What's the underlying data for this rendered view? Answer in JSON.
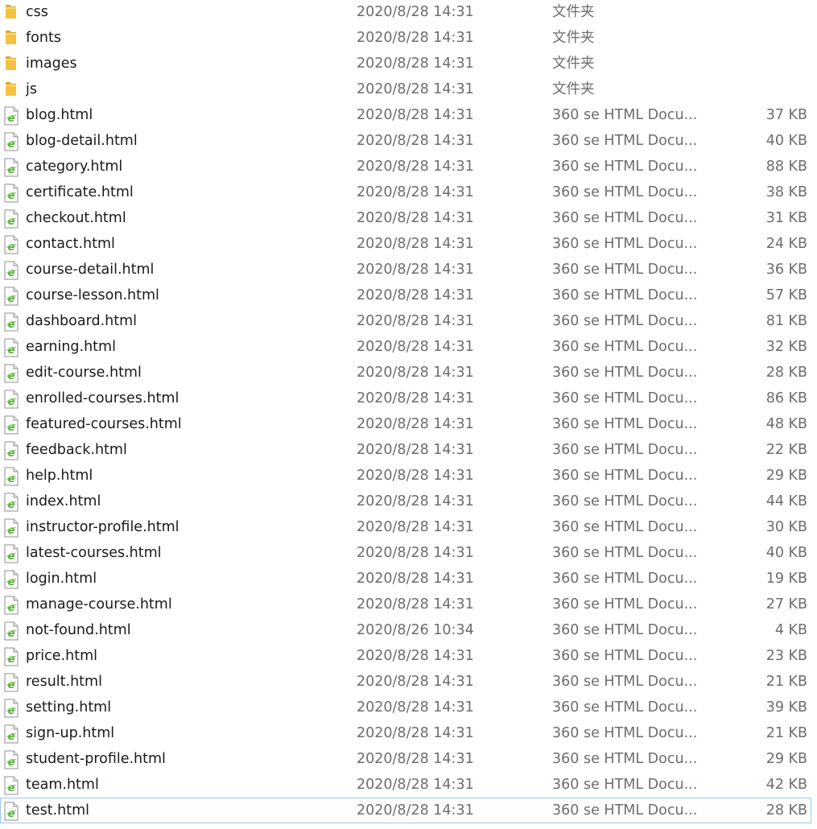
{
  "files": [
    {
      "name": "css",
      "date": "2020/8/28 14:31",
      "type": "文件夹",
      "size": "",
      "icon": "folder-icon"
    },
    {
      "name": "fonts",
      "date": "2020/8/28 14:31",
      "type": "文件夹",
      "size": "",
      "icon": "folder-icon"
    },
    {
      "name": "images",
      "date": "2020/8/28 14:31",
      "type": "文件夹",
      "size": "",
      "icon": "folder-icon"
    },
    {
      "name": "js",
      "date": "2020/8/28 14:31",
      "type": "文件夹",
      "size": "",
      "icon": "folder-icon"
    },
    {
      "name": "blog.html",
      "date": "2020/8/28 14:31",
      "type": "360 se HTML Docu...",
      "size": "37 KB",
      "icon": "html-file-icon"
    },
    {
      "name": "blog-detail.html",
      "date": "2020/8/28 14:31",
      "type": "360 se HTML Docu...",
      "size": "40 KB",
      "icon": "html-file-icon"
    },
    {
      "name": "category.html",
      "date": "2020/8/28 14:31",
      "type": "360 se HTML Docu...",
      "size": "88 KB",
      "icon": "html-file-icon"
    },
    {
      "name": "certificate.html",
      "date": "2020/8/28 14:31",
      "type": "360 se HTML Docu...",
      "size": "38 KB",
      "icon": "html-file-icon"
    },
    {
      "name": "checkout.html",
      "date": "2020/8/28 14:31",
      "type": "360 se HTML Docu...",
      "size": "31 KB",
      "icon": "html-file-icon"
    },
    {
      "name": "contact.html",
      "date": "2020/8/28 14:31",
      "type": "360 se HTML Docu...",
      "size": "24 KB",
      "icon": "html-file-icon"
    },
    {
      "name": "course-detail.html",
      "date": "2020/8/28 14:31",
      "type": "360 se HTML Docu...",
      "size": "36 KB",
      "icon": "html-file-icon"
    },
    {
      "name": "course-lesson.html",
      "date": "2020/8/28 14:31",
      "type": "360 se HTML Docu...",
      "size": "57 KB",
      "icon": "html-file-icon"
    },
    {
      "name": "dashboard.html",
      "date": "2020/8/28 14:31",
      "type": "360 se HTML Docu...",
      "size": "81 KB",
      "icon": "html-file-icon"
    },
    {
      "name": "earning.html",
      "date": "2020/8/28 14:31",
      "type": "360 se HTML Docu...",
      "size": "32 KB",
      "icon": "html-file-icon"
    },
    {
      "name": "edit-course.html",
      "date": "2020/8/28 14:31",
      "type": "360 se HTML Docu...",
      "size": "28 KB",
      "icon": "html-file-icon"
    },
    {
      "name": "enrolled-courses.html",
      "date": "2020/8/28 14:31",
      "type": "360 se HTML Docu...",
      "size": "86 KB",
      "icon": "html-file-icon"
    },
    {
      "name": "featured-courses.html",
      "date": "2020/8/28 14:31",
      "type": "360 se HTML Docu...",
      "size": "48 KB",
      "icon": "html-file-icon"
    },
    {
      "name": "feedback.html",
      "date": "2020/8/28 14:31",
      "type": "360 se HTML Docu...",
      "size": "22 KB",
      "icon": "html-file-icon"
    },
    {
      "name": "help.html",
      "date": "2020/8/28 14:31",
      "type": "360 se HTML Docu...",
      "size": "29 KB",
      "icon": "html-file-icon"
    },
    {
      "name": "index.html",
      "date": "2020/8/28 14:31",
      "type": "360 se HTML Docu...",
      "size": "44 KB",
      "icon": "html-file-icon"
    },
    {
      "name": "instructor-profile.html",
      "date": "2020/8/28 14:31",
      "type": "360 se HTML Docu...",
      "size": "30 KB",
      "icon": "html-file-icon"
    },
    {
      "name": "latest-courses.html",
      "date": "2020/8/28 14:31",
      "type": "360 se HTML Docu...",
      "size": "40 KB",
      "icon": "html-file-icon"
    },
    {
      "name": "login.html",
      "date": "2020/8/28 14:31",
      "type": "360 se HTML Docu...",
      "size": "19 KB",
      "icon": "html-file-icon"
    },
    {
      "name": "manage-course.html",
      "date": "2020/8/28 14:31",
      "type": "360 se HTML Docu...",
      "size": "27 KB",
      "icon": "html-file-icon"
    },
    {
      "name": "not-found.html",
      "date": "2020/8/26 10:34",
      "type": "360 se HTML Docu...",
      "size": "4 KB",
      "icon": "html-file-icon"
    },
    {
      "name": "price.html",
      "date": "2020/8/28 14:31",
      "type": "360 se HTML Docu...",
      "size": "23 KB",
      "icon": "html-file-icon"
    },
    {
      "name": "result.html",
      "date": "2020/8/28 14:31",
      "type": "360 se HTML Docu...",
      "size": "21 KB",
      "icon": "html-file-icon"
    },
    {
      "name": "setting.html",
      "date": "2020/8/28 14:31",
      "type": "360 se HTML Docu...",
      "size": "39 KB",
      "icon": "html-file-icon"
    },
    {
      "name": "sign-up.html",
      "date": "2020/8/28 14:31",
      "type": "360 se HTML Docu...",
      "size": "21 KB",
      "icon": "html-file-icon"
    },
    {
      "name": "student-profile.html",
      "date": "2020/8/28 14:31",
      "type": "360 se HTML Docu...",
      "size": "29 KB",
      "icon": "html-file-icon"
    },
    {
      "name": "team.html",
      "date": "2020/8/28 14:31",
      "type": "360 se HTML Docu...",
      "size": "42 KB",
      "icon": "html-file-icon"
    },
    {
      "name": "test.html",
      "date": "2020/8/28 14:31",
      "type": "360 se HTML Docu...",
      "size": "28 KB",
      "icon": "html-file-icon",
      "focused": true
    }
  ],
  "colors": {
    "name_text": "#1a1a1a",
    "meta_text": "#6d6d6d",
    "folder_yellow": "#f5c242",
    "html_icon_green": "#4caf2a",
    "focus_outline": "#99c9ef"
  }
}
